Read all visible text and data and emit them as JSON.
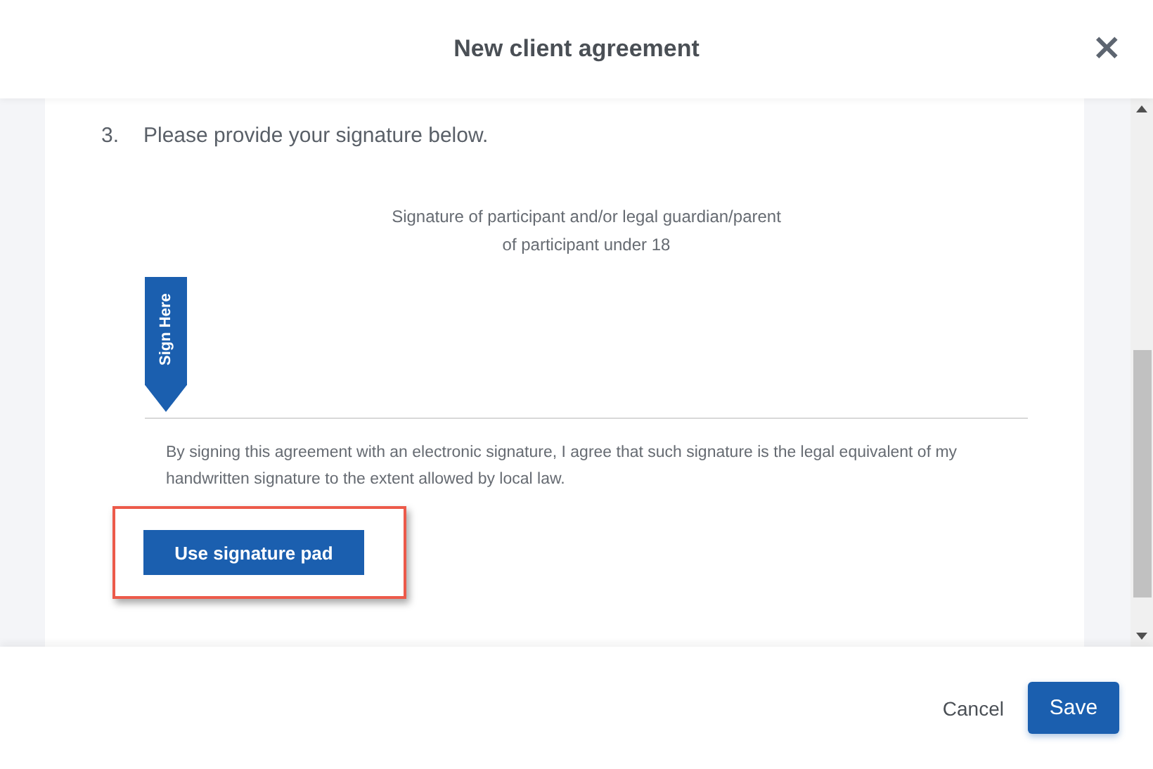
{
  "dialog": {
    "title": "New client agreement",
    "close": "×"
  },
  "step": {
    "number": "3.",
    "instruction": "Please provide your signature below."
  },
  "signature": {
    "caption_lines": [
      "Signature of participant and/or legal guardian/parent",
      "of participant under 18"
    ],
    "tab_label": "Sign Here",
    "consent": "By signing this agreement with an electronic signature, I agree that such signature is the legal equivalent of my handwritten signature to the extent allowed by local law.",
    "pad_button": {
      "label": "Use signature pad",
      "highlighted": true
    }
  },
  "footer": {
    "buttons": [
      {
        "label": "Cancel",
        "kind": "secondary"
      },
      {
        "label": "Save",
        "kind": "primary"
      }
    ]
  }
}
